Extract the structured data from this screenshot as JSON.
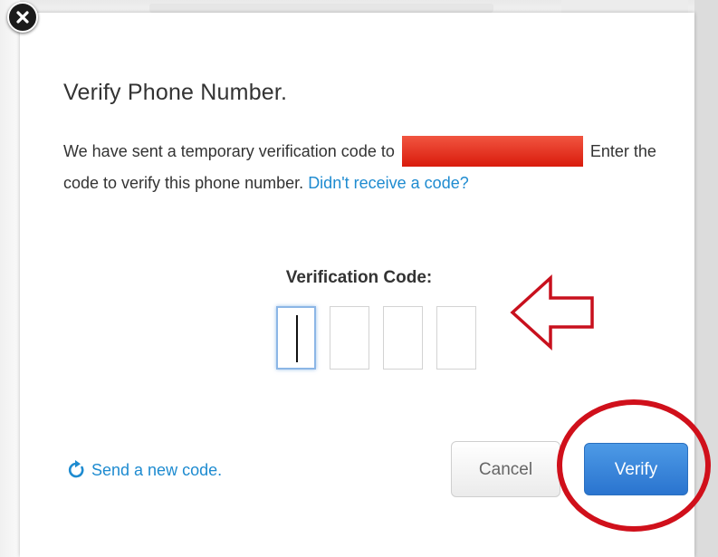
{
  "dialog": {
    "title": "Verify Phone Number.",
    "description_before": "We have sent a temporary verification code to",
    "description_after": "Enter the code to verify this phone number.",
    "help_link": "Didn't receive a code?",
    "code_label": "Verification Code:",
    "code_digits": [
      "",
      "",
      "",
      ""
    ],
    "send_new_code": "Send a new code.",
    "cancel_label": "Cancel",
    "verify_label": "Verify"
  },
  "icons": {
    "close": "close-icon",
    "refresh": "refresh-icon",
    "arrow": "arrow-left-annotation"
  },
  "colors": {
    "link": "#1e8bd0",
    "verify_button": "#3a86dc",
    "annotation_red": "#d0101b",
    "redaction": "#e8321f"
  }
}
